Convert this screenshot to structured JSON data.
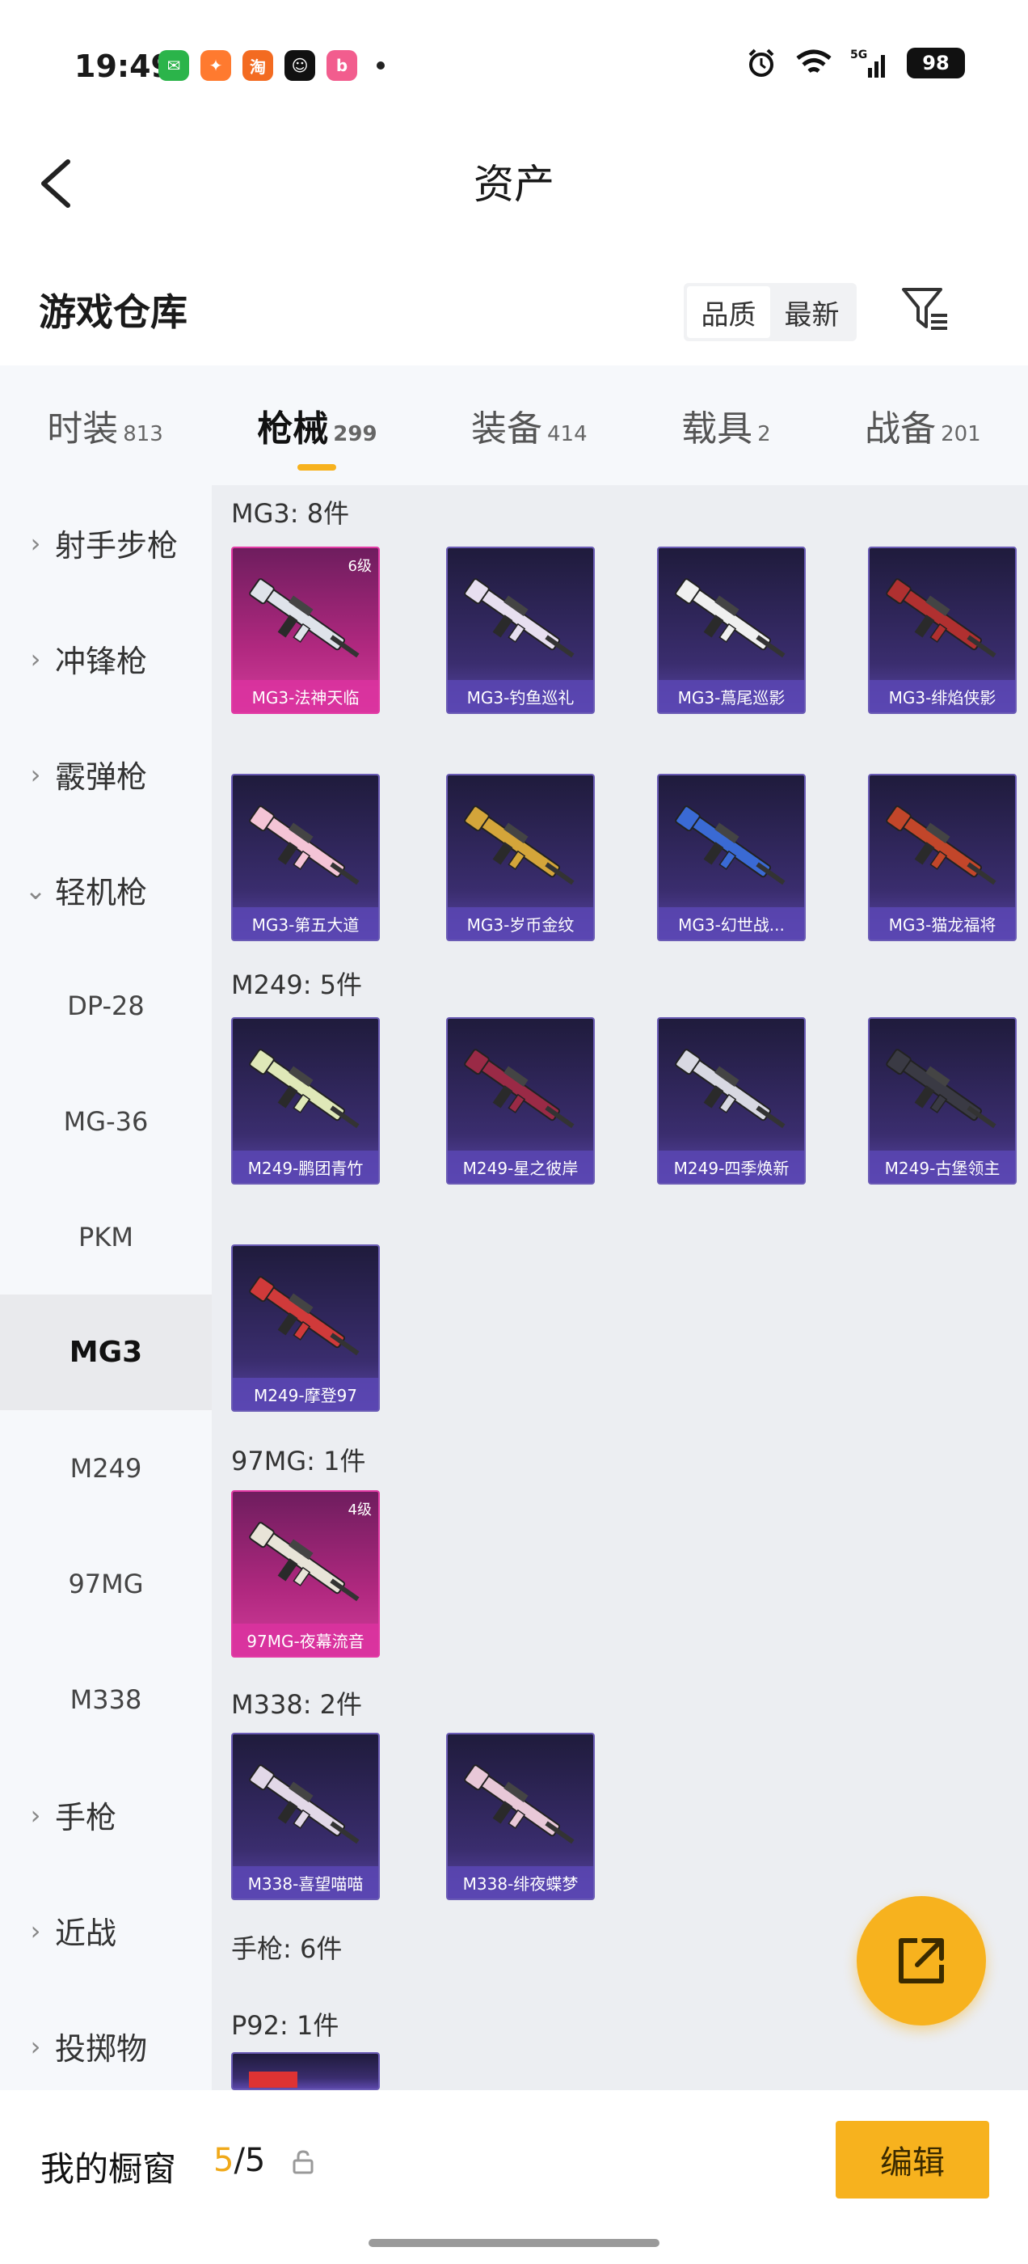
{
  "status": {
    "time": "19:49",
    "battery": "98",
    "apps": [
      {
        "icon": "wechat-icon",
        "color": "#2bb44a",
        "glyph": "✉"
      },
      {
        "icon": "game-icon",
        "color": "#ff7a2f",
        "glyph": "✦"
      },
      {
        "icon": "taobao-icon",
        "color": "#f36b21",
        "glyph": "淘"
      },
      {
        "icon": "qq-icon",
        "color": "#111111",
        "glyph": "☺"
      },
      {
        "icon": "bilibili-icon",
        "color": "#f25d8e",
        "glyph": "b"
      }
    ]
  },
  "header": {
    "title": "资产"
  },
  "section": {
    "title": "游戏仓库",
    "sort_options": [
      "品质",
      "最新"
    ],
    "sort_active": 0
  },
  "tabs": [
    {
      "label": "时装",
      "count": "813"
    },
    {
      "label": "枪械",
      "count": "299",
      "active": true
    },
    {
      "label": "装备",
      "count": "414"
    },
    {
      "label": "载具",
      "count": "2"
    },
    {
      "label": "战备",
      "count": "201"
    }
  ],
  "sidebar": [
    {
      "label": "射手步枪",
      "type": "category",
      "chevron": "right"
    },
    {
      "label": "冲锋枪",
      "type": "category",
      "chevron": "right"
    },
    {
      "label": "霰弹枪",
      "type": "category",
      "chevron": "right"
    },
    {
      "label": "轻机枪",
      "type": "category",
      "chevron": "down"
    },
    {
      "label": "DP-28",
      "type": "sub"
    },
    {
      "label": "MG-36",
      "type": "sub"
    },
    {
      "label": "PKM",
      "type": "sub"
    },
    {
      "label": "MG3",
      "type": "sub",
      "selected": true
    },
    {
      "label": "M249",
      "type": "sub"
    },
    {
      "label": "97MG",
      "type": "sub"
    },
    {
      "label": "M338",
      "type": "sub"
    },
    {
      "label": "手枪",
      "type": "category",
      "chevron": "right"
    },
    {
      "label": "近战",
      "type": "category",
      "chevron": "right"
    },
    {
      "label": "投掷物",
      "type": "category",
      "chevron": "right"
    }
  ],
  "groups": [
    {
      "title": "MG3: 8件",
      "items": [
        {
          "name": "MG3-法神天临",
          "level": "6级",
          "rarity": "pink",
          "gun_color": "#dfe3ea"
        },
        {
          "name": "MG3-钓鱼巡礼",
          "rarity": "purple",
          "gun_color": "#e7dff0"
        },
        {
          "name": "MG3-蔦尾巡影",
          "rarity": "purple",
          "gun_color": "#f0f0f0"
        },
        {
          "name": "MG3-绯焰侠影",
          "rarity": "purple",
          "gun_color": "#b03030"
        },
        {
          "name": "MG3-第五大道",
          "rarity": "purple",
          "gun_color": "#f4c4d6"
        },
        {
          "name": "MG3-岁币金纹",
          "rarity": "purple",
          "gun_color": "#d4a53a"
        },
        {
          "name": "MG3-幻世战...",
          "rarity": "purple",
          "gun_color": "#3a6ad4"
        },
        {
          "name": "MG3-猫龙福将",
          "rarity": "purple",
          "gun_color": "#c2462a"
        }
      ]
    },
    {
      "title": "M249: 5件",
      "items": [
        {
          "name": "M249-鹏团青竹",
          "rarity": "purple",
          "gun_color": "#dfe8b8"
        },
        {
          "name": "M249-星之彼岸",
          "rarity": "purple",
          "gun_color": "#9a2a46"
        },
        {
          "name": "M249-四季焕新",
          "rarity": "purple",
          "gun_color": "#d8d8e2"
        },
        {
          "name": "M249-古堡领主",
          "rarity": "purple",
          "gun_color": "#3a3a44"
        },
        {
          "name": "M249-摩登97",
          "rarity": "purple",
          "gun_color": "#d03a3a"
        }
      ]
    },
    {
      "title": "97MG: 1件",
      "items": [
        {
          "name": "97MG-夜幕流音",
          "level": "4级",
          "rarity": "pink",
          "gun_color": "#e8e4d8"
        }
      ]
    },
    {
      "title": "M338: 2件",
      "items": [
        {
          "name": "M338-喜望喵喵",
          "rarity": "purple",
          "gun_color": "#e2d8e8"
        },
        {
          "name": "M338-绯夜蝶梦",
          "rarity": "purple",
          "gun_color": "#e8c8d8"
        }
      ]
    }
  ],
  "pistol_title": "手枪: 6件",
  "p92_title": "P92: 1件",
  "bottom": {
    "label": "我的橱窗",
    "count_current": "5",
    "count_total": "/5",
    "edit_label": "编辑"
  }
}
